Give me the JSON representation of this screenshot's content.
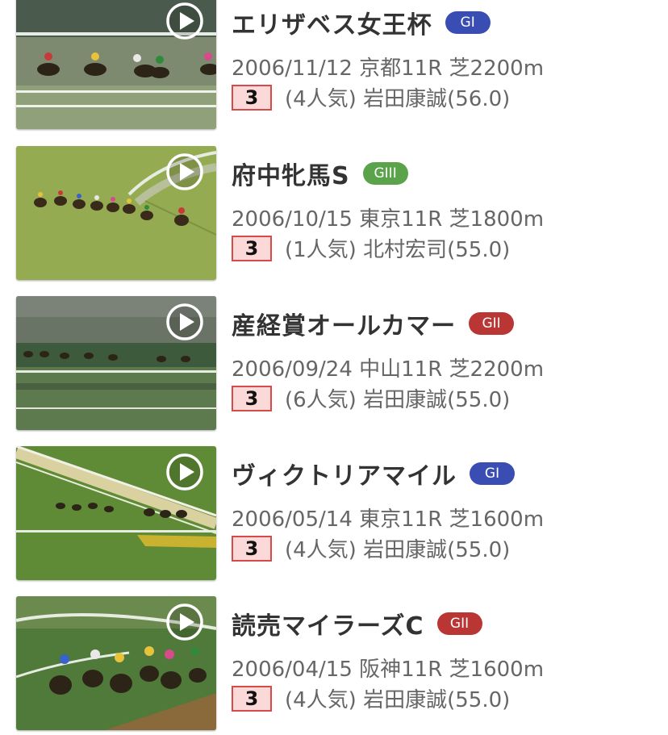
{
  "colors": {
    "grade_gi": "#3a4db3",
    "grade_gii": "#b93634",
    "grade_giii": "#5ba34a",
    "rank_bg": "#fcd9d9",
    "rank_border": "#d64a4a"
  },
  "races": [
    {
      "title": "エリザベス女王杯",
      "grade": "GI",
      "grade_color": "#3a4db3",
      "info": "2006/11/12 京都11R 芝2200m",
      "rank": "3",
      "detail": "(4人気) 岩田康誠(56.0)",
      "thumbnail_icon": "play-icon"
    },
    {
      "title": "府中牝馬S",
      "grade": "GIII",
      "grade_color": "#5ba34a",
      "info": "2006/10/15 東京11R 芝1800m",
      "rank": "3",
      "detail": "(1人気) 北村宏司(55.0)",
      "thumbnail_icon": "play-icon"
    },
    {
      "title": "産経賞オールカマー",
      "grade": "GII",
      "grade_color": "#b93634",
      "info": "2006/09/24 中山11R 芝2200m",
      "rank": "3",
      "detail": "(6人気) 岩田康誠(55.0)",
      "thumbnail_icon": "play-icon"
    },
    {
      "title": "ヴィクトリアマイル",
      "grade": "GI",
      "grade_color": "#3a4db3",
      "info": "2006/05/14 東京11R 芝1600m",
      "rank": "3",
      "detail": "(4人気) 岩田康誠(55.0)",
      "thumbnail_icon": "play-icon"
    },
    {
      "title": "読売マイラーズC",
      "grade": "GII",
      "grade_color": "#b93634",
      "info": "2006/04/15 阪神11R 芝1600m",
      "rank": "3",
      "detail": "(4人気) 岩田康誠(55.0)",
      "thumbnail_icon": "play-icon"
    }
  ]
}
